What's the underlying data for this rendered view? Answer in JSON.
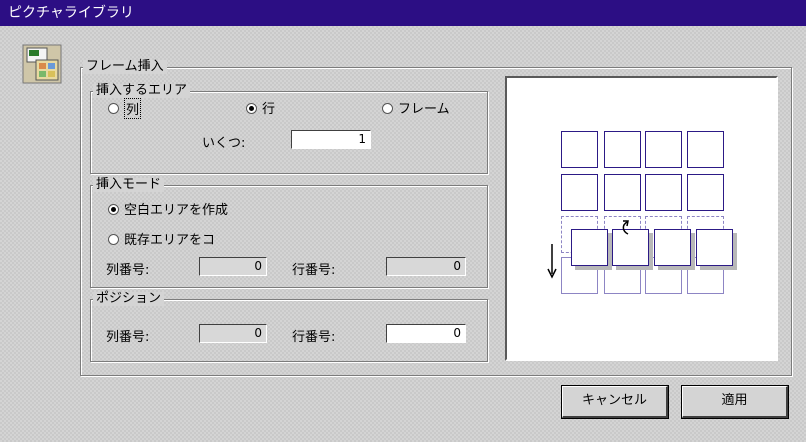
{
  "window": {
    "title": "ピクチャライブラリ"
  },
  "frame_insert": {
    "label": "フレーム挿入",
    "area": {
      "label": "挿入するエリア",
      "options": [
        {
          "label": "列",
          "checked": false
        },
        {
          "label": "行",
          "checked": true
        },
        {
          "label": "フレーム",
          "checked": false
        }
      ],
      "count_label": "いくつ:",
      "count_value": "1"
    },
    "mode": {
      "label": "挿入モード",
      "options": [
        {
          "label": "空白エリアを作成",
          "checked": true
        },
        {
          "label": "既存エリアをコ",
          "checked": false
        }
      ],
      "col_label": "列番号:",
      "col_value": "0",
      "row_label": "行番号:",
      "row_value": "0"
    },
    "position": {
      "label": "ポジション",
      "col_label": "列番号:",
      "col_value": "0",
      "row_label": "行番号:",
      "row_value": "0"
    }
  },
  "preview": {
    "icon": "insert-row-diagram"
  },
  "buttons": {
    "cancel": "キャンセル",
    "apply": "適用"
  },
  "colors": {
    "titlebar": "#2c0e84",
    "frame_border": "#2c1a86"
  }
}
